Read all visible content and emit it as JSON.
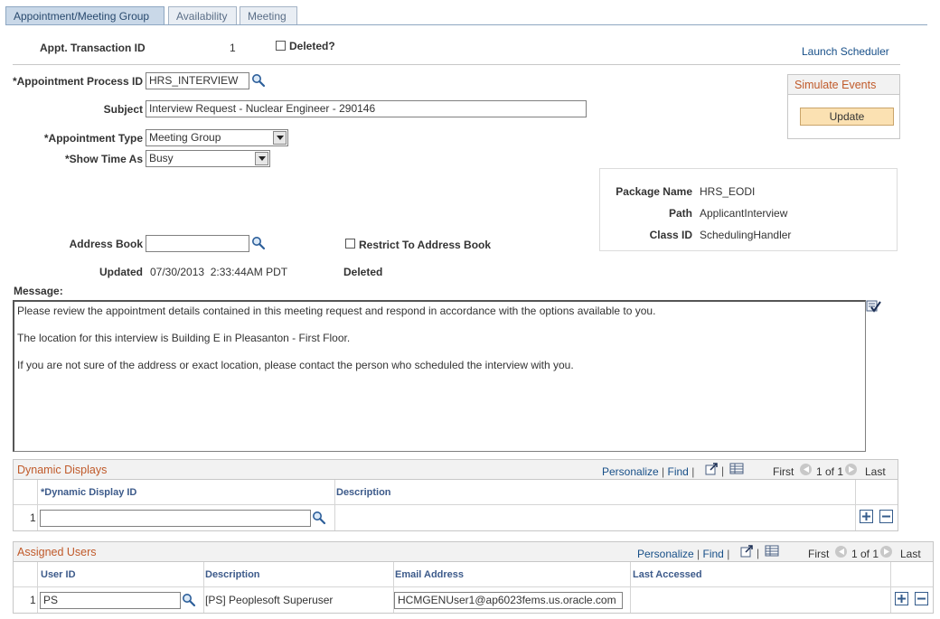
{
  "tabs": [
    {
      "label": "Appointment/Meeting Group",
      "active": true
    },
    {
      "label": "Availability",
      "active": false
    },
    {
      "label": "Meeting",
      "active": false
    }
  ],
  "header": {
    "transaction_label": "Appt. Transaction ID",
    "transaction_value": "1",
    "deleted_label": "Deleted?",
    "launch_link": "Launch Scheduler"
  },
  "form": {
    "process_label": "*Appointment Process ID",
    "process_value": "HRS_INTERVIEW",
    "subject_label": "Subject",
    "subject_value": "Interview Request - Nuclear Engineer - 290146",
    "type_label": "*Appointment Type",
    "type_value": "Meeting Group",
    "show_label": "*Show Time As",
    "show_value": "Busy",
    "address_label": "Address Book",
    "address_value": "",
    "restrict_label": "Restrict To Address Book",
    "updated_label": "Updated",
    "updated_value": "07/30/2013  2:33:44AM PDT",
    "deleted_status": "Deleted"
  },
  "simulate": {
    "title": "Simulate Events",
    "button": "Update"
  },
  "package": {
    "name_label": "Package Name",
    "name_value": "HRS_EODI",
    "path_label": "Path",
    "path_value": "ApplicantInterview",
    "class_label": "Class ID",
    "class_value": "SchedulingHandler"
  },
  "message": {
    "label": "Message:",
    "lines": [
      "Please review the appointment details contained in this meeting request and respond in accordance with the options available to you.",
      "The location for this interview is Building E in Pleasanton - First Floor.",
      "If you are not sure of the address or exact location, please contact the person who scheduled the interview with you."
    ]
  },
  "grid_nav": {
    "personalize": "Personalize",
    "find": "Find",
    "first": "First",
    "count": "1 of 1",
    "last": "Last"
  },
  "dynamic": {
    "title": "Dynamic Displays",
    "col_id": "*Dynamic Display ID",
    "col_desc": "Description",
    "row_num": "1",
    "id_value": "",
    "desc_value": ""
  },
  "users": {
    "title": "Assigned Users",
    "col_user": "User ID",
    "col_desc": "Description",
    "col_email": "Email Address",
    "col_last": "Last Accessed",
    "row_num": "1",
    "user_value": "PS",
    "desc_value": "[PS] Peoplesoft Superuser",
    "email_value": "HCMGENUser1@ap6023fems.us.oracle.com",
    "last_value": ""
  },
  "colors": {
    "link": "#174f88",
    "grid_title": "#c05a2a",
    "update_button": "#fbe1b2"
  }
}
